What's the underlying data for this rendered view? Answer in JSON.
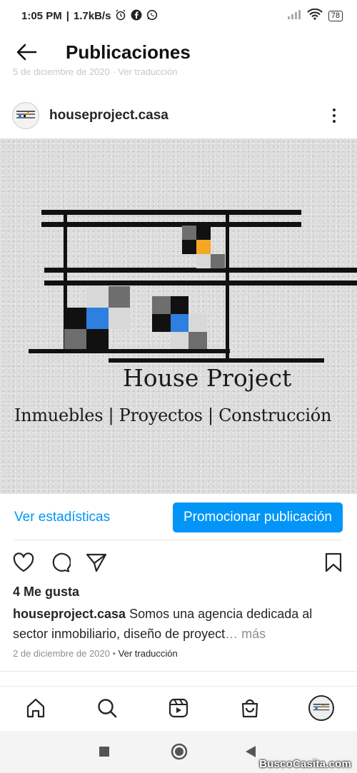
{
  "status_bar": {
    "time": "1:05 PM",
    "speed": "1.7kB/s",
    "battery": "78",
    "icons": [
      "alarm-icon",
      "facebook-icon",
      "whatsapp-icon",
      "signal-icon",
      "wifi-icon",
      "battery-icon"
    ]
  },
  "header": {
    "title": "Publicaciones",
    "peek_text": "5 de diciembre de 2020 · Ver traducción"
  },
  "post": {
    "username": "houseproject.casa",
    "image": {
      "brand_title": "House Project",
      "brand_tagline": "Inmuebles |  Proyectos | Construcción",
      "accent_colors": {
        "orange": "#f5a623",
        "blue": "#2d7fe0",
        "black": "#111111",
        "gray": "#6e6e6e",
        "light": "#d8d8d8"
      }
    },
    "stats_label": "Ver estadísticas",
    "promote_label": "Promocionar publicación",
    "likes": "4 Me gusta",
    "caption_user": "houseproject.casa",
    "caption_text": "Somos una agencia dedicada al sector inmobiliario, diseño de proyect",
    "caption_more": "… más",
    "date": "2 de diciembre de 2020",
    "dot": " • ",
    "translate": "Ver traducción"
  },
  "bottom_nav": [
    "home-icon",
    "search-icon",
    "reels-icon",
    "shop-icon",
    "profile-avatar"
  ],
  "watermark": "BuscoCasita.com",
  "colors": {
    "accent": "#0095f6",
    "text": "#262626",
    "muted": "#8e8e8e"
  }
}
